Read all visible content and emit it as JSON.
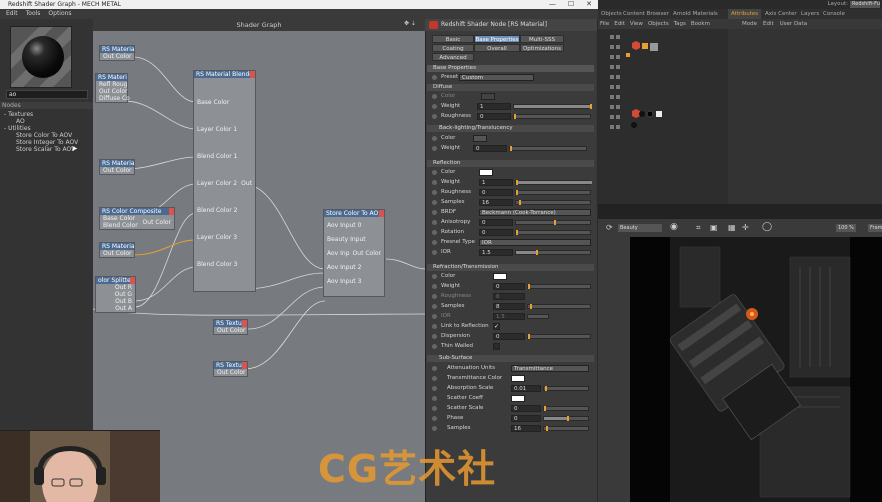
{
  "window": {
    "title": "Redshift Shader Graph - MECH METAL",
    "controls": [
      "—",
      "☐",
      "✕"
    ]
  },
  "menu": [
    "Edit",
    "Tools",
    "Options"
  ],
  "left": {
    "search_value": "ao",
    "nodes_label": "Nodes",
    "tree": [
      "- Textures",
      "AO",
      "- Utilities",
      "Store Color To AOV",
      "Store Integer To AOV",
      "Store Scalar To AOV"
    ]
  },
  "graph": {
    "title": "Shader Graph",
    "nodes": {
      "rs_material_1": {
        "title": "RS Materia",
        "ports": [
          "Out Color"
        ]
      },
      "rs_material_2": {
        "title": "RS Materia",
        "ports": [
          "Refl Roug",
          "Out Color",
          "Diffuse Co"
        ]
      },
      "rs_material_3": {
        "title": "RS Materia",
        "ports": [
          "Out Color"
        ]
      },
      "color_composite": {
        "title": "RS Color Composite",
        "ports": [
          "Base Color",
          "Out Color",
          "Blend Color"
        ]
      },
      "rs_material_4": {
        "title": "RS Materia",
        "ports": [
          "Out Color"
        ]
      },
      "color_splitter": {
        "title": "olor Splitter",
        "ports": [
          "Out R",
          "Out G",
          "Out B",
          "Out A"
        ]
      },
      "material_blender": {
        "title": "RS Material Blender",
        "ports": [
          "Base Color",
          "Layer Color 1",
          "Blend Color 1",
          "Layer Color 2",
          "Out",
          "Blend Color 2",
          "Layer Color 3",
          "Blend Color 3"
        ]
      },
      "store_color_aov": {
        "title": "Store Color To AO",
        "ports": [
          "Aov Input 0",
          "Beauty Input",
          "Aov Inp",
          "Out Color",
          "Aov Input 2",
          "Aov Input 3"
        ]
      },
      "rs_texture_1": {
        "title": "RS Texture",
        "ports": [
          "Out Color"
        ]
      },
      "rs_texture_2": {
        "title": "RS Texture",
        "ports": [
          "Out Color"
        ]
      }
    }
  },
  "attr": {
    "title": "Redshift Shader Node [RS Material]",
    "tabs": [
      "Basic",
      "Base Properties",
      "Multi-SSS",
      "Coating",
      "Overall",
      "Optimizations",
      "Advanced"
    ],
    "section_base": "Base Properties",
    "preset_label": "Preset",
    "preset_value": "Custom",
    "diffuse": {
      "header": "Diffuse",
      "color": "Color",
      "weight": "Weight",
      "weight_val": "1",
      "roughness": "Roughness",
      "roughness_val": "0"
    },
    "backlight": {
      "header": "Back-lighting/Translucency",
      "color": "Color",
      "weight": "Weight",
      "weight_val": "0"
    },
    "reflection": {
      "header": "Reflection",
      "color": "Color",
      "weight": "Weight",
      "weight_val": "1",
      "roughness": "Roughness",
      "roughness_val": "0",
      "samples": "Samples",
      "samples_val": "16",
      "brdf": "BRDF",
      "brdf_val": "Beckmann (Cook-Torrance)",
      "anisotropy": "Anisotropy",
      "anisotropy_val": "0",
      "rotation": "Rotation",
      "rotation_val": "0",
      "fresnel": "Fresnel Type",
      "fresnel_val": "IOR",
      "ior": "IOR",
      "ior_val": "1.5"
    },
    "refraction": {
      "header": "Refraction/Transmission",
      "color": "Color",
      "weight": "Weight",
      "weight_val": "0",
      "roughness": "Roughness",
      "roughness_val": "0",
      "ior": "IOR",
      "ior_val": "1.5",
      "samples": "Samples",
      "samples_val": "8",
      "link": "Link to Reflection",
      "link_val": "✓",
      "dispersion": "Dispersion",
      "dispersion_val": "0",
      "thin": "Thin Walled"
    },
    "subsurface": {
      "header": "Sub-Surface",
      "atten": "Attenuation Units",
      "atten_val": "Transmittance",
      "trans": "Transmittance Color",
      "absorp": "Absorption Scale",
      "absorp_val": "0.01",
      "scatter_coeff": "Scatter Coeff",
      "scatter_scale": "Scatter Scale",
      "scatter_scale_val": "0",
      "phase": "Phase",
      "phase_val": "0",
      "samples": "Samples",
      "samples_val": "16"
    }
  },
  "right": {
    "tabs": [
      "Objects",
      "Content Browser",
      "Arnold Materials",
      "Attributes",
      "Axis Center",
      "Layers",
      "Console"
    ],
    "obj_menu": [
      "File",
      "Edit",
      "View",
      "Objects",
      "Tags",
      "Bookm"
    ],
    "attr_menu": [
      "Mode",
      "Edit",
      "User Data"
    ],
    "layout_label": "Layout:",
    "layout_value": "Redshift-Fu",
    "render_preset": "Beauty",
    "zoom": "100 %",
    "vp_extra": "Fram"
  },
  "watermark": "CG艺术社",
  "colors": {
    "accent": "#e8a030",
    "node_header": "#4a6a92",
    "graph_bg": "#777b7f",
    "tab_active": "#6d8fb8"
  }
}
